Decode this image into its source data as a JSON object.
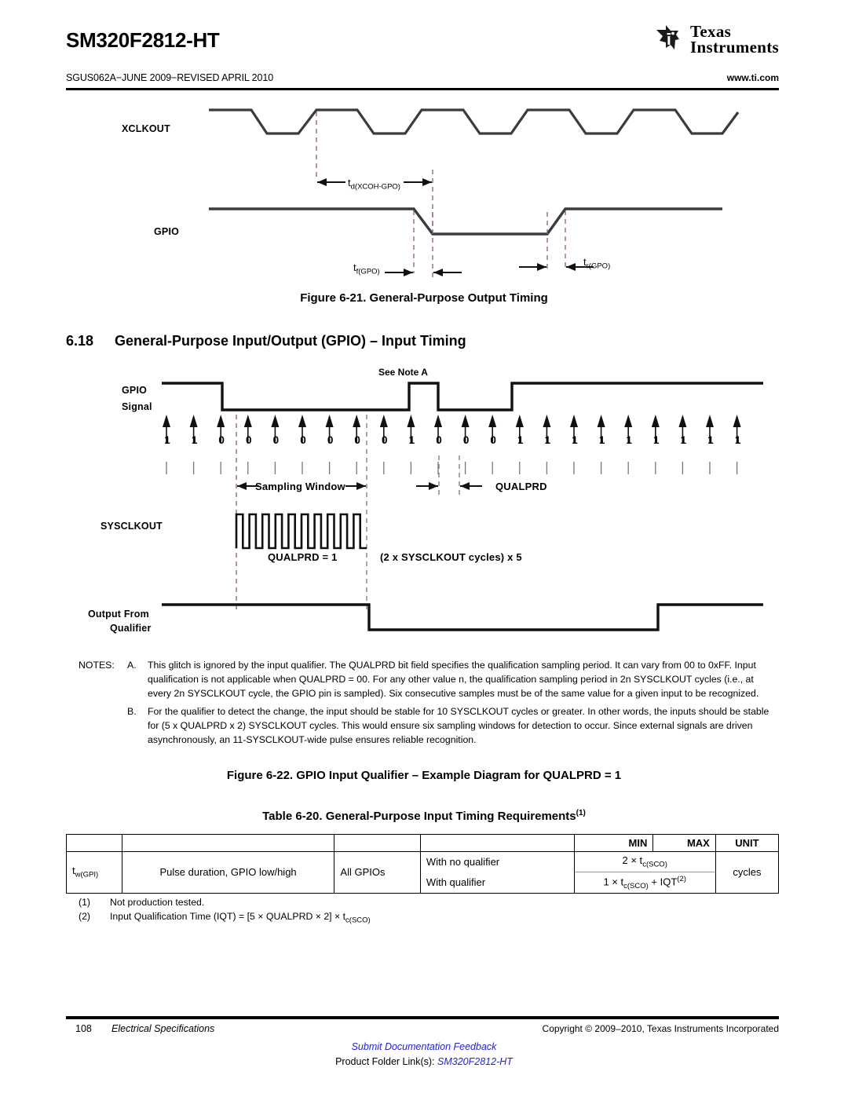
{
  "header": {
    "doc_title": "SM320F2812-HT",
    "doc_id": "SGUS062A−JUNE 2009−REVISED APRIL 2010",
    "url": "www.ti.com",
    "logo_line1": "Texas",
    "logo_line2": "Instruments"
  },
  "figure21": {
    "caption": "Figure 6-21. General-Purpose Output Timing",
    "signals": {
      "clk": "XCLKOUT",
      "gpio": "GPIO"
    },
    "timing_labels": {
      "td": "t",
      "td_sub": "d(XCOH-GPO)",
      "tf": "t",
      "tf_sub": "f(GPO)",
      "tr": "t",
      "tr_sub": "r(GPO)"
    }
  },
  "section": {
    "number": "6.18",
    "title": "General-Purpose Input/Output (GPIO) – Input Timing"
  },
  "figure22": {
    "caption": "Figure 6-22. GPIO Input Qualifier – Example Diagram for QUALPRD = 1",
    "note_marker": "See Note A",
    "signals": {
      "gpio_l1": "GPIO",
      "gpio_l2": "Signal",
      "sysclkout": "SYSCLKOUT",
      "out_l1": "Output From",
      "out_l2": "Qualifier"
    },
    "samples": [
      "1",
      "1",
      "0",
      "0",
      "0",
      "0",
      "0",
      "0",
      "0",
      "1",
      "0",
      "0",
      "0",
      "1",
      "1",
      "1",
      "1",
      "1",
      "1",
      "1",
      "1",
      "1"
    ],
    "markers": {
      "sampling_window": "Sampling Window",
      "qualprd": "QUALPRD",
      "qualprd_value": "QUALPRD = 1",
      "cycles": "(2 x SYSCLKOUT cycles) x 5"
    },
    "sysclkout_pulses": 10
  },
  "notes": {
    "lead": "NOTES:",
    "items": [
      {
        "letter": "A.",
        "text": "This glitch is ignored by the input qualifier. The QUALPRD bit field specifies the qualification sampling period. It can vary from 00 to 0xFF. Input qualification is not applicable when QUALPRD = 00. For any other value n, the qualification sampling period in 2n SYSCLKOUT cycles (i.e., at every 2n SYSCLKOUT cycle, the GPIO pin is sampled). Six consecutive samples must be of the same value for a given input to be recognized."
      },
      {
        "letter": "B.",
        "text": "For the qualifier to detect the change, the input should be stable for 10 SYSCLKOUT cycles or greater. In other words, the inputs should be stable for (5 x QUALPRD x 2) SYSCLKOUT cycles. This would ensure six sampling windows for detection to occur. Since external signals are driven asynchronously, an 11-SYSCLKOUT-wide pulse ensures reliable recognition."
      }
    ]
  },
  "table": {
    "caption": "Table 6-20. General-Purpose Input Timing Requirements",
    "caption_sup": "(1)",
    "headers": {
      "min": "MIN",
      "max": "MAX",
      "unit": "UNIT"
    },
    "rows": [
      {
        "symbol": "t",
        "symbol_sub": "w(GPI)",
        "param": "Pulse duration, GPIO low/high",
        "scope": "All GPIOs",
        "conditions": [
          {
            "label": "With no qualifier",
            "min_pre": "2 × t",
            "min_sub": "c(SCO)",
            "min_post": "",
            "min_sup": ""
          },
          {
            "label": "With qualifier",
            "min_pre": "1 × t",
            "min_sub": "c(SCO)",
            "min_post": " + IQT",
            "min_sup": "(2)"
          }
        ],
        "unit": "cycles"
      }
    ],
    "footnotes": [
      {
        "n": "(1)",
        "text": "Not production tested."
      },
      {
        "n": "(2)",
        "text_pre": "Input Qualification Time (IQT) = [5 × QUALPRD × 2] × t",
        "text_sub": "c(SCO)"
      }
    ]
  },
  "footer": {
    "page_number": "108",
    "section_name": "Electrical Specifications",
    "copyright": "Copyright © 2009–2010, Texas Instruments Incorporated",
    "feedback_link": "Submit Documentation Feedback",
    "product_folder_label": "Product Folder Link(s): ",
    "product_folder_link": "SM320F2812-HT"
  },
  "colors": {
    "line": "#3a3a42",
    "heavy": "#111111",
    "dash": "#8a5a7a",
    "link": "#2222cc"
  }
}
